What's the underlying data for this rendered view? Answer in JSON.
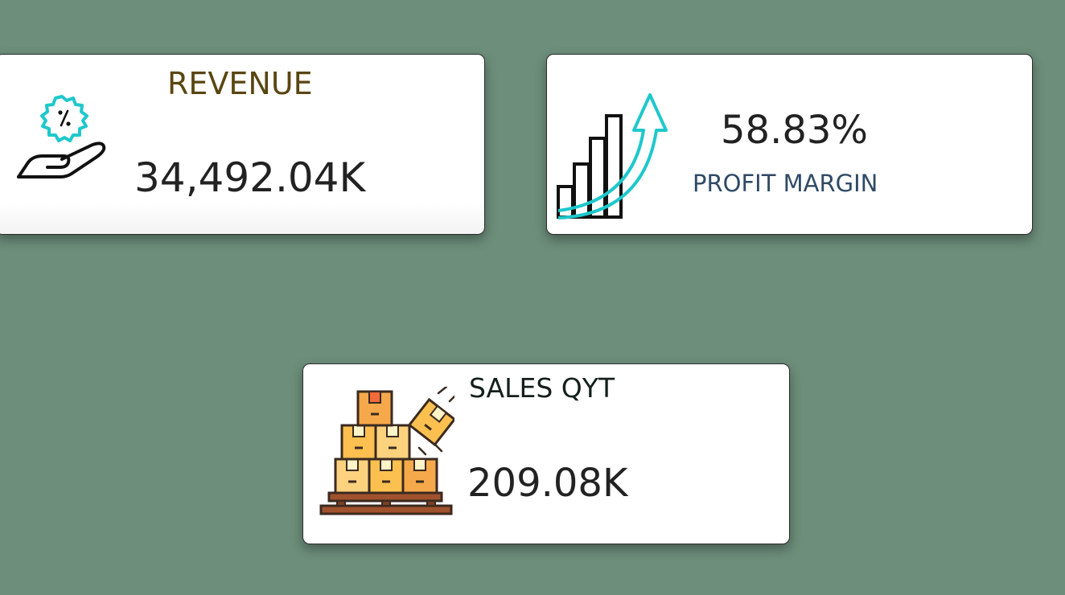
{
  "colors": {
    "background": "#6d8e7b",
    "card": "#ffffff",
    "revenue_title": "#5a4612",
    "profit_title": "#2f4a66",
    "sales_title": "#14201a",
    "value_text": "#222222",
    "accent_teal": "#1ec8cc",
    "box_orange": "#f6a94a",
    "box_light": "#fcd27e",
    "pallet_brown": "#a0522d"
  },
  "cards": {
    "revenue": {
      "title": "REVENUE",
      "value": "34,492.04K",
      "icon": "hand-discount-icon"
    },
    "profit": {
      "title": "PROFIT MARGIN",
      "value": "58.83%",
      "icon": "growth-chart-icon"
    },
    "sales": {
      "title": "SALES QYT",
      "value": "209.08K",
      "icon": "boxes-pallet-icon"
    }
  }
}
